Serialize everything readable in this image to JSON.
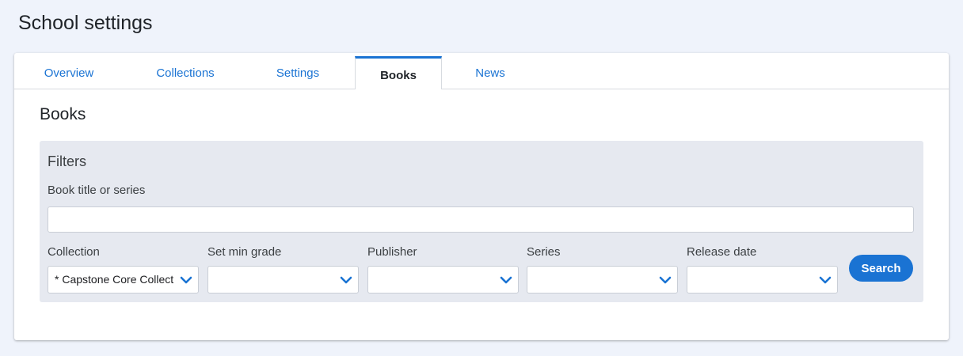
{
  "page": {
    "title": "School settings"
  },
  "tabs": [
    {
      "label": "Overview",
      "active": false
    },
    {
      "label": "Collections",
      "active": false
    },
    {
      "label": "Settings",
      "active": false
    },
    {
      "label": "Books",
      "active": true
    },
    {
      "label": "News",
      "active": false
    }
  ],
  "section": {
    "title": "Books"
  },
  "filters": {
    "heading": "Filters",
    "title_field": {
      "label": "Book title or series",
      "value": "",
      "placeholder": ""
    },
    "selects": [
      {
        "label": "Collection",
        "value": "* Capstone Core Collection"
      },
      {
        "label": "Set min grade",
        "value": ""
      },
      {
        "label": "Publisher",
        "value": ""
      },
      {
        "label": "Series",
        "value": ""
      },
      {
        "label": "Release date",
        "value": ""
      }
    ],
    "search_label": "Search"
  },
  "colors": {
    "accent": "#1a73d3",
    "page_background": "#eff3fb",
    "filters_background": "#e6e9f0"
  },
  "icons": {
    "select_arrow": "chevron-down-icon"
  }
}
